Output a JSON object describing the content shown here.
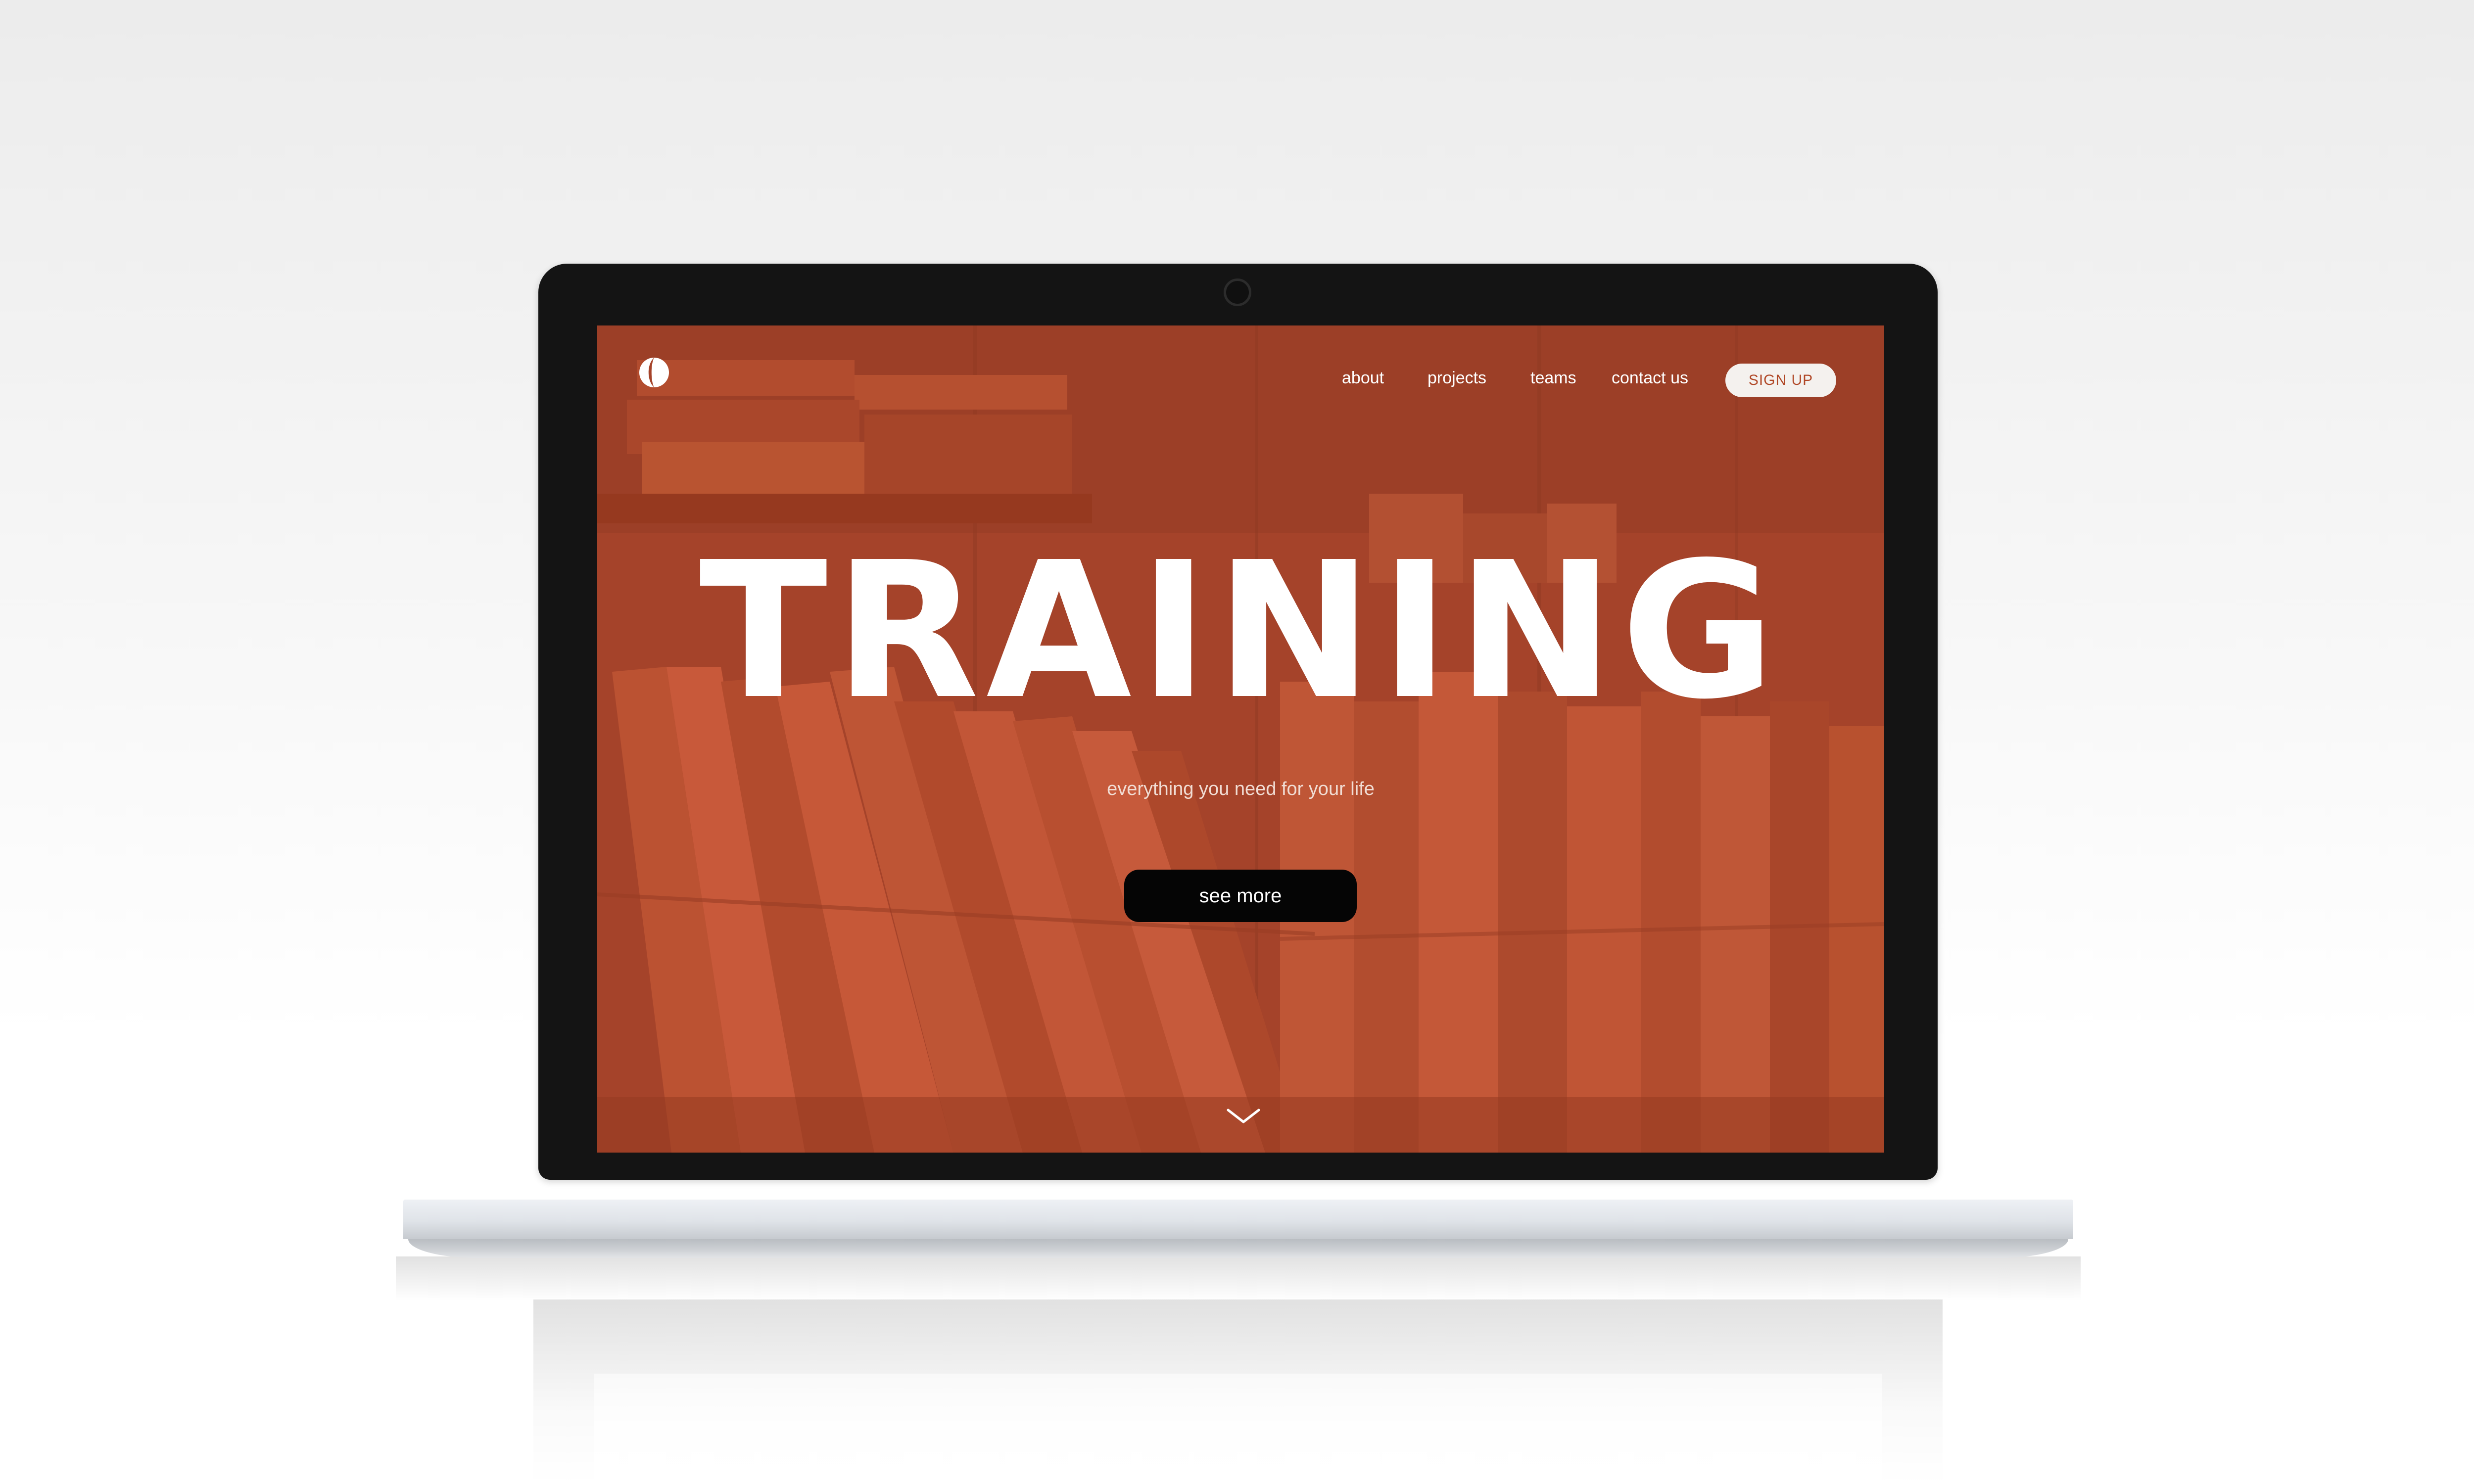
{
  "brand": {
    "logo_icon": "half-moon-logo-icon"
  },
  "nav": {
    "items": [
      {
        "label": "about"
      },
      {
        "label": "projects"
      },
      {
        "label": "teams"
      },
      {
        "label": "contact us"
      }
    ],
    "signup_label": "SIGN UP"
  },
  "hero": {
    "title": "TRAINING",
    "subtitle": "everything you need for your life",
    "cta_label": "see more",
    "scroll_icon": "chevron-down-icon"
  },
  "colors": {
    "accent": "#a5432a",
    "accent_dark": "#8c3720",
    "signup_text": "#b04726",
    "cta_background": "#050505",
    "bezel": "#141414"
  }
}
